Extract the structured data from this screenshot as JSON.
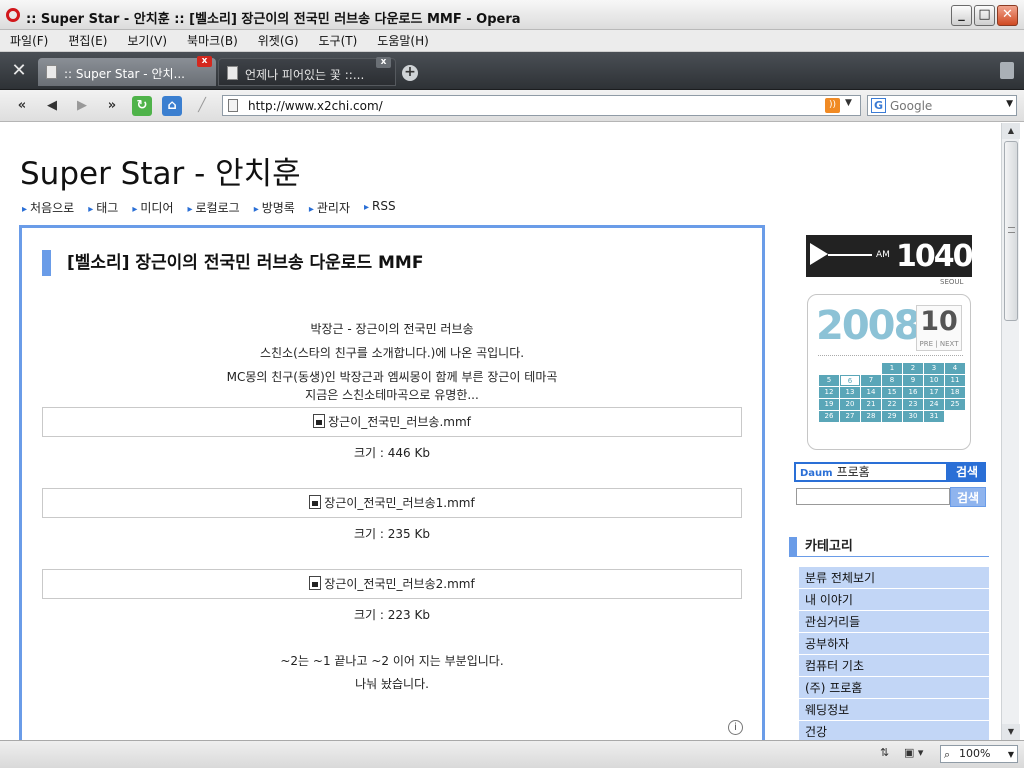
{
  "window": {
    "title": ":: Super Star - 안치훈 :: [벨소리] 장근이의 전국민 러브송 다운로드 MMF - Opera"
  },
  "menubar": [
    "파일(F)",
    "편집(E)",
    "보기(V)",
    "북마크(B)",
    "위젯(G)",
    "도구(T)",
    "도움말(H)"
  ],
  "tabs": [
    {
      "label": ":: Super Star - 안치...",
      "active": true
    },
    {
      "label": "언제나 피어있는 꽃 ::...",
      "active": false
    }
  ],
  "address": {
    "url": "http://www.x2chi.com/",
    "search_placeholder": "Google"
  },
  "site": {
    "title": "Super Star - 안치훈",
    "nav": [
      "처음으로",
      "태그",
      "미디어",
      "로컬로그",
      "방명록",
      "관리자",
      "RSS"
    ]
  },
  "post": {
    "title": "[벨소리] 장근이의 전국민 러브송 다운로드 MMF",
    "intro": [
      "박장근 - 장근이의 전국민 러브송",
      "스친소(스타의 친구를 소개합니다.)에 나온 곡입니다.",
      "MC몽의 친구(동생)인 박장근과 엠씨몽이 함께 부른 장근이 테마곡",
      "지금은 스친소테마곡으로 유명한..."
    ],
    "files": [
      {
        "name": "장근이_전국민_러브송.mmf",
        "size": "크기 : 446 Kb"
      },
      {
        "name": "장근이_전국민_러브송1.mmf",
        "size": "크기 : 235 Kb"
      },
      {
        "name": "장근이_전국민_러브송2.mmf",
        "size": "크기 : 223 Kb"
      }
    ],
    "outro": [
      "~2는 ~1 끝나고 ~2 이어 지는 부분입니다.",
      "나눠 놨습니다."
    ]
  },
  "sidebar": {
    "radio": {
      "am": "AM",
      "freq": "1040",
      "city": "SEOUL"
    },
    "calendar": {
      "year": "2008",
      "month": "10",
      "prev": "PRE",
      "next": "NEXT",
      "days": [
        "",
        "",
        "",
        "1",
        "2",
        "3",
        "4",
        "5",
        "6",
        "7",
        "8",
        "9",
        "10",
        "11",
        "12",
        "13",
        "14",
        "15",
        "16",
        "17",
        "18",
        "19",
        "20",
        "21",
        "22",
        "23",
        "24",
        "25",
        "26",
        "27",
        "28",
        "29",
        "30",
        "31"
      ],
      "today": "6"
    },
    "daum_search": {
      "logo": "Daum",
      "value": "프로홈",
      "button": "검색"
    },
    "blog_search": {
      "value": "",
      "button": "검색"
    },
    "category": {
      "heading": "카테고리",
      "items": [
        "분류 전체보기",
        "내 이야기",
        "관심거리들",
        "공부하자",
        "컴퓨터 기초",
        "(주) 프로홈",
        "웨딩정보",
        "건강"
      ]
    }
  },
  "status": {
    "zoom": "100%"
  }
}
